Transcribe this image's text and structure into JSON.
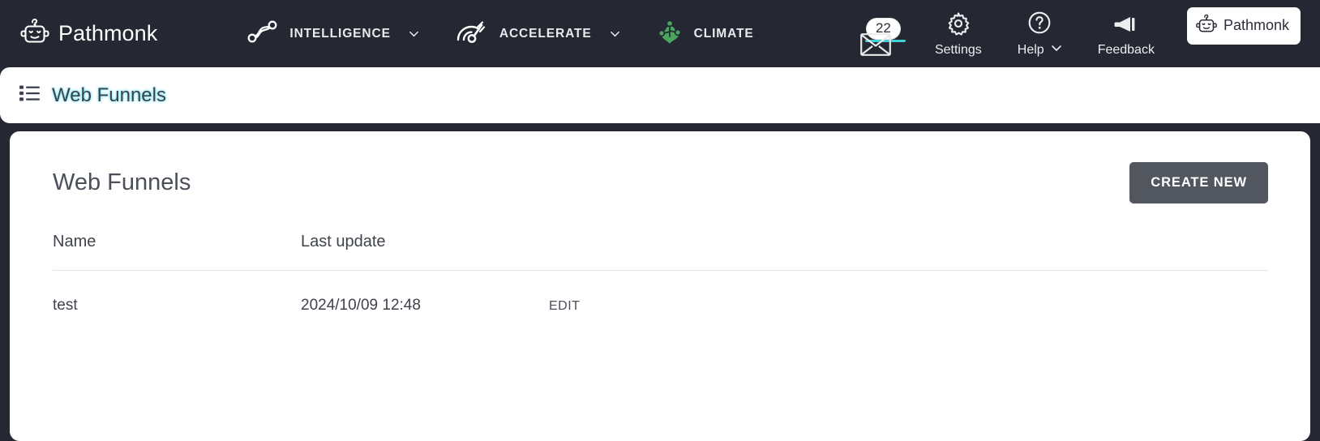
{
  "brand": {
    "name": "Pathmonk",
    "logo_icon": "robot-icon"
  },
  "nav": {
    "items": [
      {
        "label": "INTELLIGENCE",
        "icon": "path-nodes-icon",
        "has_caret": true
      },
      {
        "label": "ACCELERATE",
        "icon": "speedometer-icon",
        "has_caret": true
      },
      {
        "label": "CLIMATE",
        "icon": "green-tree-icon",
        "has_caret": false
      }
    ]
  },
  "header_right": {
    "messages": {
      "badge_count": "22",
      "icon": "envelope-icon",
      "accent_color": "#3fd0d8"
    },
    "settings": {
      "label": "Settings",
      "icon": "gear-icon"
    },
    "help": {
      "label": "Help",
      "icon": "question-circle-icon",
      "has_caret": true
    },
    "feedback": {
      "label": "Feedback",
      "icon": "megaphone-icon"
    },
    "account": {
      "label": "Pathmonk",
      "icon": "robot-icon"
    }
  },
  "breadcrumb": {
    "label": "Web Funnels",
    "icon": "list-icon"
  },
  "main": {
    "title": "Web Funnels",
    "create_button": "CREATE NEW",
    "table": {
      "columns": [
        "Name",
        "Last update",
        ""
      ],
      "rows": [
        {
          "name": "test",
          "last_update": "2024/10/09 12:48",
          "action": "EDIT"
        }
      ]
    }
  },
  "colors": {
    "header_bg": "#252832",
    "card_bg": "#ffffff",
    "button_bg": "#52565e",
    "accent_cyan": "#3fd0d8",
    "climate_green": "#4aa65c",
    "text_dark": "#3f434c"
  }
}
